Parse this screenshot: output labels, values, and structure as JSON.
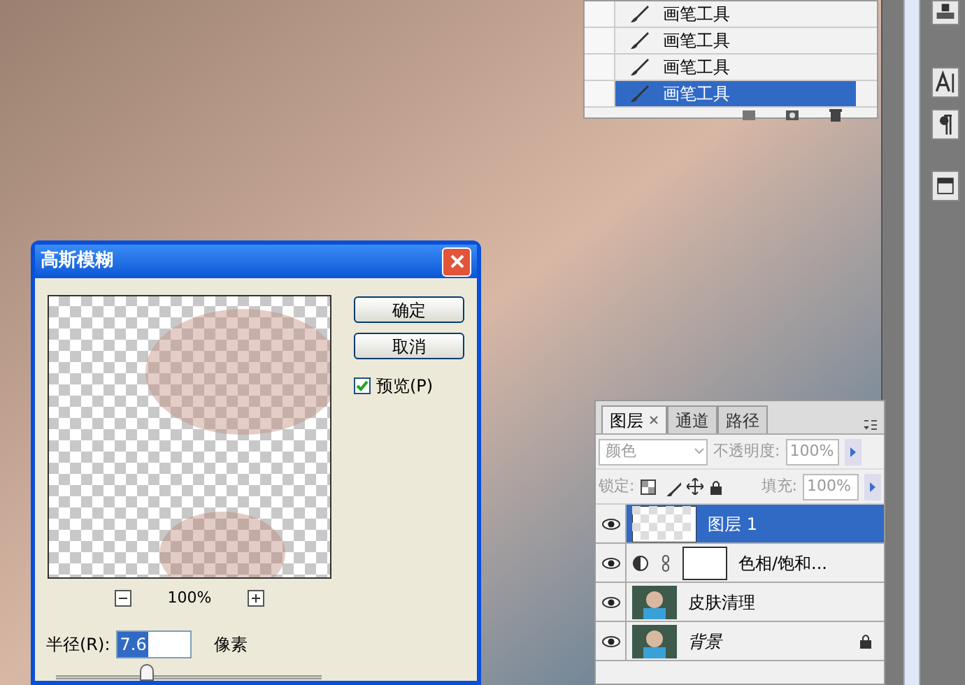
{
  "history_panel": {
    "items": [
      {
        "label": "画笔工具",
        "selected": false
      },
      {
        "label": "画笔工具",
        "selected": false
      },
      {
        "label": "画笔工具",
        "selected": false
      },
      {
        "label": "画笔工具",
        "selected": true
      }
    ]
  },
  "dialog": {
    "title": "高斯模糊",
    "buttons": [
      "确定",
      "取消"
    ],
    "preview_checkbox": {
      "label": "预览(P)",
      "checked": true
    },
    "zoom": "100%",
    "radius": {
      "label": "半径(R):",
      "value": "7.6",
      "unit": "像素",
      "level": 0.34
    }
  },
  "layers_panel": {
    "tabs": [
      {
        "label": "图层",
        "selected": true
      },
      {
        "label": "通道",
        "selected": false
      },
      {
        "label": "路径",
        "selected": false
      }
    ],
    "blend_mode": {
      "value": "颜色",
      "disabled": true
    },
    "opacity": {
      "label": "不透明度:",
      "value": "100%",
      "disabled": true
    },
    "lock_label": "锁定:",
    "fill": {
      "label": "填充:",
      "value": "100%",
      "disabled": true
    },
    "layers": [
      {
        "name": "图层 1",
        "kind": "transparent",
        "selected": true,
        "visible": true,
        "locked": false
      },
      {
        "name": "色相/饱和...",
        "kind": "adjustment",
        "selected": false,
        "visible": true,
        "locked": false
      },
      {
        "name": "皮肤清理",
        "kind": "photo",
        "selected": false,
        "visible": true,
        "locked": false
      },
      {
        "name": "背景",
        "kind": "photo",
        "selected": false,
        "visible": true,
        "locked": true
      }
    ]
  }
}
